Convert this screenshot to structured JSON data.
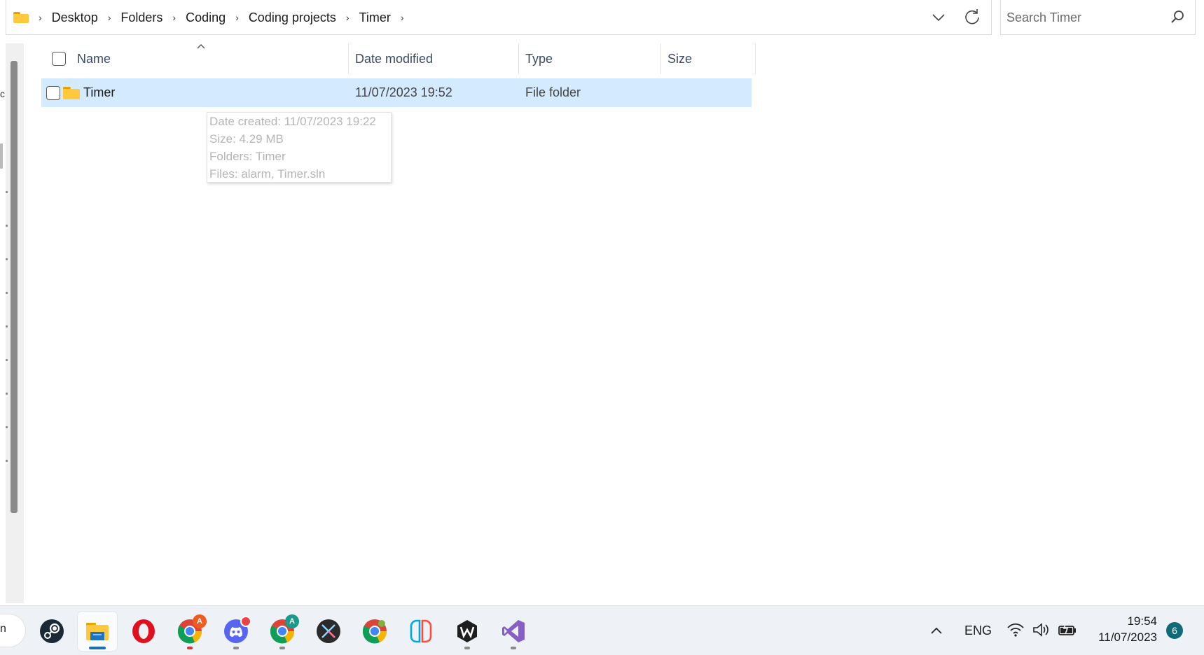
{
  "address_bar": {
    "breadcrumbs": [
      "Desktop",
      "Folders",
      "Coding",
      "Coding projects",
      "Timer"
    ]
  },
  "search": {
    "placeholder": "Search Timer"
  },
  "columns": {
    "name": "Name",
    "date_modified": "Date modified",
    "type": "Type",
    "size": "Size"
  },
  "rows": [
    {
      "name": "Timer",
      "date_modified": "11/07/2023 19:52",
      "type": "File folder",
      "size": ""
    }
  ],
  "tooltip": {
    "date_created": "Date created: 11/07/2023 19:22",
    "size": "Size: 4.29 MB",
    "folders": "Folders: Timer",
    "files": "Files: alarm, Timer.sln"
  },
  "left_edge": {
    "text": "c",
    "start_text": "n"
  },
  "taskbar": {
    "apps": [
      {
        "icon": "steam-icon"
      },
      {
        "icon": "file-explorer-icon",
        "active": true
      },
      {
        "icon": "opera-icon"
      },
      {
        "icon": "chrome-icon",
        "badge": "A",
        "badge_color": "#f25b1f"
      },
      {
        "icon": "discord-icon"
      },
      {
        "icon": "chrome-profile-icon",
        "badge": "A",
        "badge_color": "#1a9a8a"
      },
      {
        "icon": "capcut-icon"
      },
      {
        "icon": "chrome-dev-icon"
      },
      {
        "icon": "nintendo-switch-icon"
      },
      {
        "icon": "wattpad-w-icon"
      },
      {
        "icon": "visual-studio-icon"
      }
    ],
    "tray": {
      "language": "ENG",
      "time": "19:54",
      "date": "11/07/2023",
      "notification_count": "6"
    }
  },
  "colors": {
    "selection": "#cce8ff",
    "folder": "#ffc83d",
    "accent": "#1a6fb0"
  }
}
